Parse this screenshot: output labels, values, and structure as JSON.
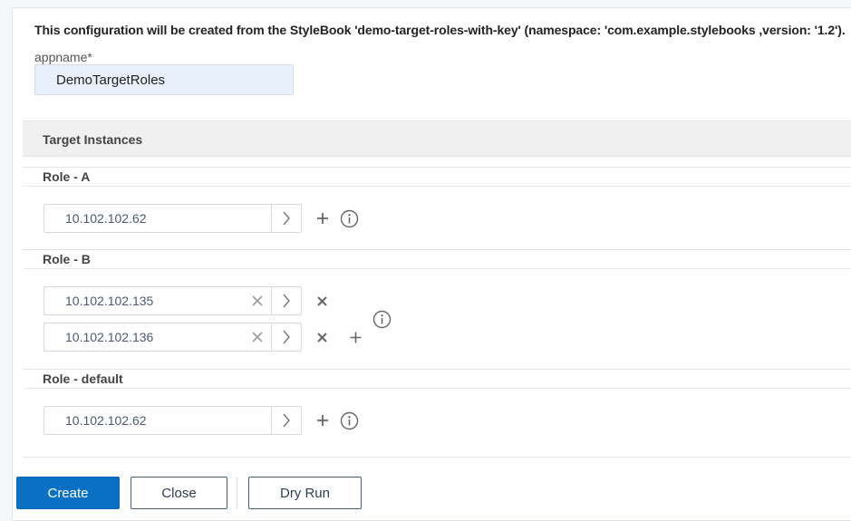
{
  "intro_text": "This configuration will be created from the StyleBook 'demo-target-roles-with-key' (namespace: 'com.example.stylebooks ,version: '1.2').",
  "appname": {
    "label": "appname*",
    "value": "DemoTargetRoles"
  },
  "target_instances": {
    "title": "Target Instances",
    "roles": [
      {
        "title": "Role - A",
        "instances": [
          "10.102.102.62"
        ]
      },
      {
        "title": "Role - B",
        "instances": [
          "10.102.102.135",
          "10.102.102.136"
        ]
      },
      {
        "title": "Role - default",
        "instances": [
          "10.102.102.62"
        ]
      }
    ]
  },
  "icons": {
    "select": "chevron-right-icon",
    "add": "plus-icon",
    "info": "info-icon",
    "clear": "clear-x-icon",
    "remove": "remove-x-icon"
  },
  "buttons": {
    "create": "Create",
    "close": "Close",
    "dry_run": "Dry Run"
  },
  "colors": {
    "primary": "#0a70c4",
    "input_highlight": "#e8f0fc",
    "value_text": "#4a5a74"
  }
}
